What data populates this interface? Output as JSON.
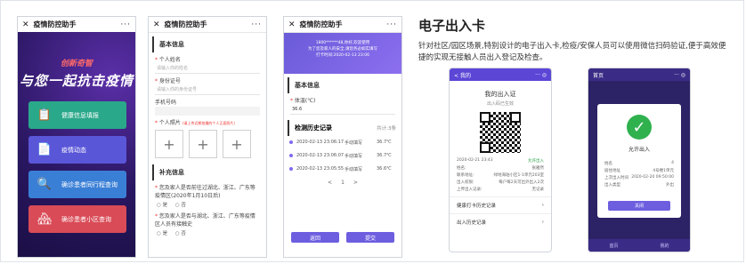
{
  "phone1": {
    "title": "疫情防控助手",
    "close": "✕",
    "more": "···",
    "slogan_top": "创新奇智",
    "slogan_main": "与您一起抗击疫情",
    "buttons": [
      {
        "label": "健康信息填报",
        "color": "#2aa88a",
        "icon": "📋"
      },
      {
        "label": "疫情动态",
        "color": "#5a56d8",
        "icon": "📄"
      },
      {
        "label": "确诊患者同行程查询",
        "color": "#3a7fd6",
        "icon": "🔍"
      },
      {
        "label": "确诊患者小区查询",
        "color": "#d94b57",
        "icon": "🏘"
      }
    ]
  },
  "phone2": {
    "title": "疫情防控助手",
    "close": "✕",
    "more": "···",
    "basic_section": "基本信息",
    "name_label": "个人姓名",
    "name_placeholder": "请输入你的姓名",
    "id_label": "身份证号",
    "id_placeholder": "请输入你的身份证号",
    "phone_label": "手机号码",
    "phone_value": "",
    "photo_label": "个人照片",
    "photo_hint": "(请上传近期拍摄的个人正面照片)",
    "supp_section": "补充信息",
    "q1": "您及家人是否前往过湖北、浙江、广东等疫情区(2020年1月10日后)",
    "q1_yes": "是",
    "q1_no": "否",
    "q2": "您及家人是否与湖北、浙江、广东等疫情区人员有接触史",
    "q2_yes": "是",
    "q2_no": "否"
  },
  "phone3": {
    "title": "疫情防控助手",
    "close": "✕",
    "more": "···",
    "banner_line1": "1800******48,你好,欢迎使用",
    "banner_line2": "为了您及家人的安全,请您务必如实填写",
    "banner_line3": "打卡时间:2020-02-13 23:06",
    "basic_section": "基本信息",
    "temp_label": "体温(℃)",
    "temp_value": "36.6",
    "history_section": "检测历史记录",
    "total": "共计:3条",
    "records": [
      {
        "date": "2020-02-13 23:06:17",
        "mode": "手动填写",
        "temp": "36.7℃"
      },
      {
        "date": "2020-02-13 23:06:07",
        "mode": "手动填写",
        "temp": "36.7℃"
      },
      {
        "date": "2020-02-13 23:05:55",
        "mode": "手动填写",
        "temp": "36.6℃"
      }
    ],
    "pager_prev": "<",
    "pager_page": "1",
    "pager_next": ">",
    "back_button": "返回",
    "submit_button": "提交"
  },
  "heading": "电子出入卡",
  "description": "针对社区/园区场景,特别设计的电子出入卡,检疫/安保人员可以使用微信扫码验证,便于高效便捷的实现无接触人员出入登记及检查。",
  "phone4": {
    "back": "<",
    "bar_title": "我的",
    "pass_title": "我的出入证",
    "pass_sub": "出入码已生效",
    "time": "2020-02-21 23:43",
    "status": "允许出入",
    "rows": [
      {
        "k": "姓名:",
        "v": "张雅然"
      },
      {
        "k": "联系地址:",
        "v": "绿地海珀小区1-1单元203室"
      },
      {
        "k": "出入权限:",
        "v": "每户每2天可出外出入2次"
      },
      {
        "k": "上传出入记录:",
        "v": "无记录"
      }
    ],
    "link1": "健康打卡历史记录",
    "link2": "出入历史记录"
  },
  "phone5": {
    "bar_title": "首页",
    "allow": "允许出入",
    "rows": [
      {
        "k": "姓名",
        "v": "4"
      },
      {
        "k": "居住地址",
        "v": "4号楼1单元"
      },
      {
        "k": "上次出入时间",
        "v": "2020-02-20 09:50:00"
      },
      {
        "k": "出入类型",
        "v": "外出"
      }
    ],
    "close_button": "关闭",
    "tab1": "首页",
    "tab2": "我的"
  }
}
